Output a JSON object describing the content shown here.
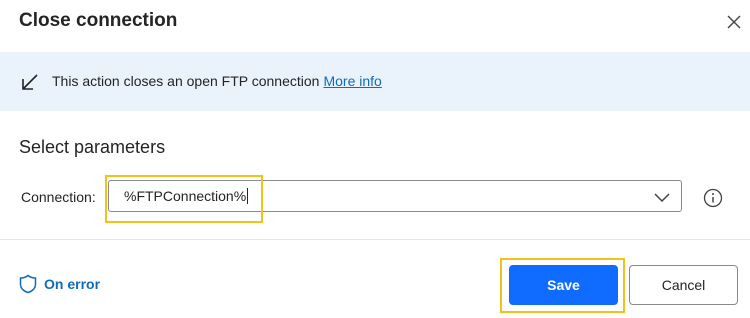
{
  "dialog": {
    "title": "Close connection",
    "close_icon": "close-icon"
  },
  "info": {
    "icon": "arrow-down-left-icon",
    "text": "This action closes an open FTP connection",
    "link": "More info"
  },
  "parameters": {
    "heading": "Select parameters",
    "connection": {
      "label": "Connection:",
      "value": "%FTPConnection%"
    }
  },
  "footer": {
    "on_error": "On error",
    "save": "Save",
    "cancel": "Cancel"
  },
  "colors": {
    "accent": "#0f6cff",
    "link": "#0f6cbd",
    "info_background": "#eaf2fb",
    "highlight": "#f2c21a"
  }
}
